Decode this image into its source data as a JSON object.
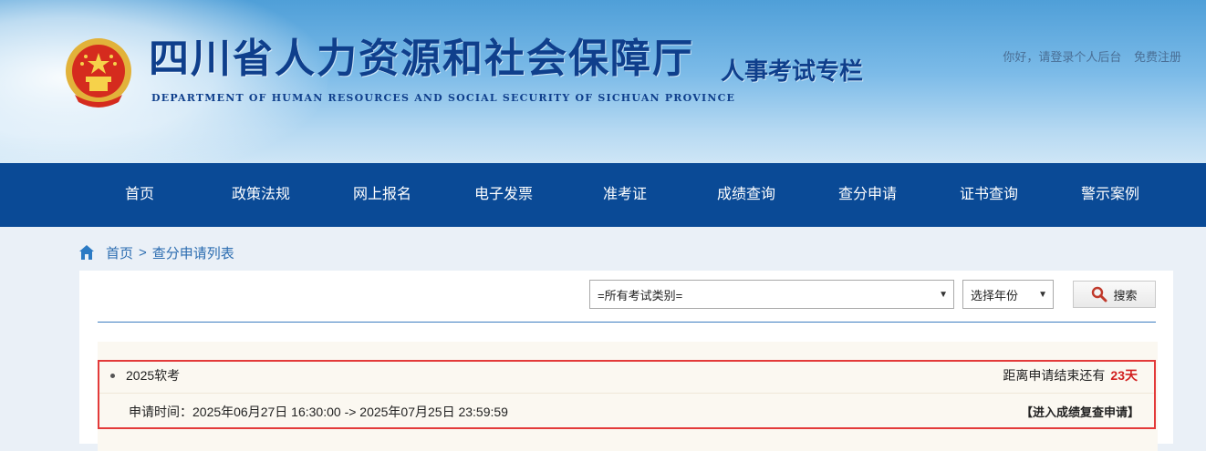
{
  "header": {
    "site_title": "四川省人力资源和社会保障厅",
    "site_subtitle": "DEPARTMENT OF HUMAN RESOURCES AND SOCIAL SECURITY OF SICHUAN PROVINCE",
    "column_title": "人事考试专栏",
    "greeting_login": "你好，请登录个人后台",
    "register": "免费注册",
    "emblem_icon": "national-emblem-icon"
  },
  "nav": {
    "items": [
      {
        "label": "首页"
      },
      {
        "label": "政策法规"
      },
      {
        "label": "网上报名"
      },
      {
        "label": "电子发票"
      },
      {
        "label": "准考证"
      },
      {
        "label": "成绩查询"
      },
      {
        "label": "查分申请"
      },
      {
        "label": "证书查询"
      },
      {
        "label": "警示案例"
      }
    ]
  },
  "breadcrumb": {
    "home": "首页",
    "separator": ">",
    "current": "查分申请列表"
  },
  "filters": {
    "exam_type_selected": "=所有考试类别=",
    "year_selected": "选择年份",
    "search_label": "搜索"
  },
  "list": {
    "items": [
      {
        "name": "2025软考",
        "countdown_prefix": "距离申请结束还有",
        "countdown_days": "23天",
        "time_label": "申请时间：2025年06月27日 16:30:00 -> 2025年07月25日 23:59:59",
        "action": "【进入成绩复查申请】"
      }
    ]
  },
  "colors": {
    "nav_bg": "#0a4a96",
    "title_blue": "#0f3f8c",
    "highlight_border": "#e33a3a",
    "countdown_red": "#d11f1f"
  }
}
